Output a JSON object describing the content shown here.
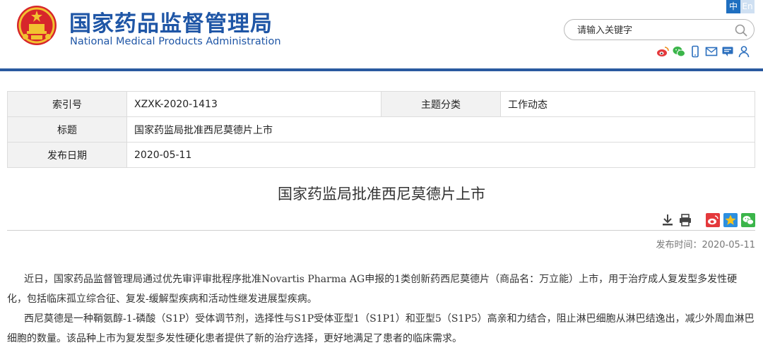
{
  "header": {
    "site_name_cn": "国家药品监督管理局",
    "site_name_en": "National Medical Products Administration",
    "lang_zh": "中",
    "lang_en": "En",
    "search_placeholder": "请输入关键字",
    "tools": [
      "weibo-icon",
      "wechat-icon",
      "mobile-icon",
      "mail-icon",
      "comment-icon",
      "user-icon"
    ]
  },
  "info_table": {
    "index_label": "索引号",
    "index_value": "XZXK-2020-1413",
    "topic_label": "主题分类",
    "topic_value": "工作动态",
    "title_label": "标题",
    "title_value": "国家药监局批准西尼莫德片上市",
    "date_label": "发布日期",
    "date_value": "2020-05-11"
  },
  "article": {
    "title": "国家药监局批准西尼莫德片上市",
    "publish_time": "发布时间：2020-05-11",
    "paragraphs": [
      "近日，国家药品监督管理局通过优先审评审批程序批准Novartis Pharma AG申报的1类创新药西尼莫德片（商品名：万立能）上市，用于治疗成人复发型多发性硬化，包括临床孤立综合征、复发-缓解型疾病和活动性继发进展型疾病。",
      "西尼莫德是一种鞘氨醇-1-磷酸（S1P）受体调节剂，选择性与S1P受体亚型1（S1P1）和亚型5（S1P5）高亲和力结合，阻止淋巴细胞从淋巴结逸出，减少外周血淋巴细胞的数量。该品种上市为复发型多发性硬化患者提供了新的治疗选择，更好地满足了患者的临床需求。"
    ]
  },
  "colors": {
    "brand_blue": "#1f56a6",
    "divider_blue": "#2a5aa0",
    "table_key_bg": "#f2f2f2",
    "weibo_red": "#e4393c",
    "wechat_green": "#3bb54a"
  }
}
